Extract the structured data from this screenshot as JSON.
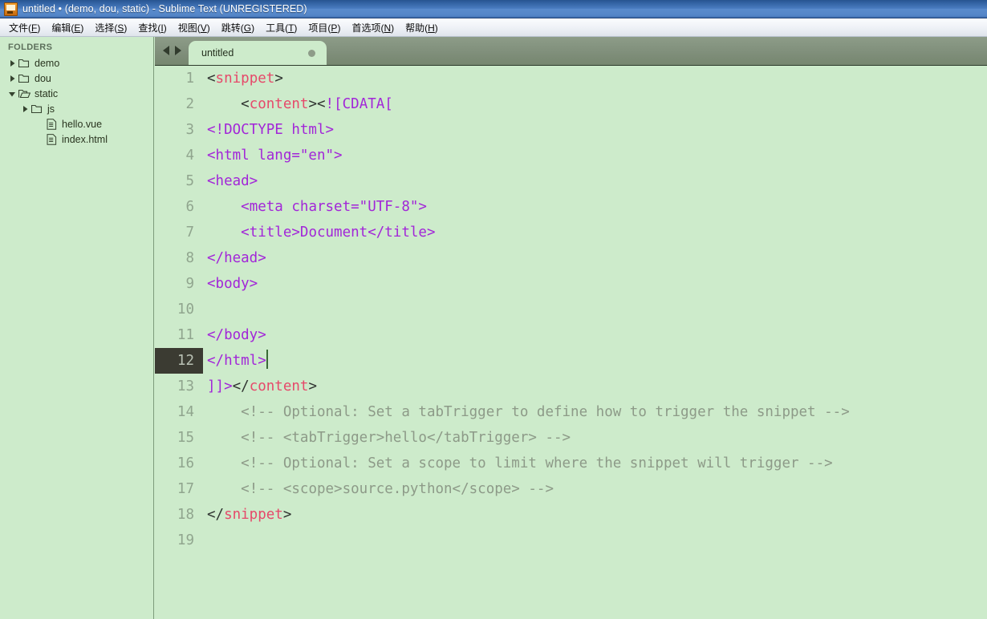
{
  "window": {
    "title": "untitled • (demo, dou, static) - Sublime Text (UNREGISTERED)",
    "icon": "sublime-text-icon"
  },
  "menubar": {
    "items": [
      {
        "label": "文件(F)"
      },
      {
        "label": "编辑(E)"
      },
      {
        "label": "选择(S)"
      },
      {
        "label": "查找(I)"
      },
      {
        "label": "视图(V)"
      },
      {
        "label": "跳转(G)"
      },
      {
        "label": "工具(T)"
      },
      {
        "label": "项目(P)"
      },
      {
        "label": "首选项(N)"
      },
      {
        "label": "帮助(H)"
      }
    ]
  },
  "sidebar": {
    "caption": "FOLDERS",
    "tree": [
      {
        "label": "demo",
        "type": "folder",
        "state": "collapsed",
        "depth": 0
      },
      {
        "label": "dou",
        "type": "folder",
        "state": "collapsed",
        "depth": 0
      },
      {
        "label": "static",
        "type": "folder",
        "state": "expanded",
        "depth": 0
      },
      {
        "label": "js",
        "type": "folder",
        "state": "collapsed",
        "depth": 1
      },
      {
        "label": "hello.vue",
        "type": "file",
        "state": "none",
        "depth": 2
      },
      {
        "label": "index.html",
        "type": "file",
        "state": "none",
        "depth": 2
      }
    ]
  },
  "tabstrip": {
    "prev_label": "",
    "next_label": "",
    "tabs": [
      {
        "label": "untitled",
        "dirty": true,
        "active": true
      }
    ]
  },
  "editor": {
    "active_line": 12,
    "colors": {
      "background": "#cdebcb",
      "tag": "#e6496a",
      "punctuation": "#2f3330",
      "plain_text": "#a226d8",
      "comment": "#8d9a88",
      "gutter_text": "#90a58e",
      "active_gutter_bg": "#3b3b32",
      "tabbar": "#808f7b"
    },
    "lines": [
      {
        "n": "1",
        "segments": [
          {
            "t": "punc",
            "s": "<"
          },
          {
            "t": "tag",
            "s": "snippet"
          },
          {
            "t": "punc",
            "s": ">"
          }
        ]
      },
      {
        "n": "2",
        "segments": [
          {
            "t": "punc",
            "s": "    <"
          },
          {
            "t": "tag",
            "s": "content"
          },
          {
            "t": "punc",
            "s": "><"
          },
          {
            "t": "plain",
            "s": "![CDATA["
          }
        ]
      },
      {
        "n": "3",
        "segments": [
          {
            "t": "plain",
            "s": "<!DOCTYPE html>"
          }
        ]
      },
      {
        "n": "4",
        "segments": [
          {
            "t": "plain",
            "s": "<html lang=\"en\">"
          }
        ]
      },
      {
        "n": "5",
        "segments": [
          {
            "t": "plain",
            "s": "<head>"
          }
        ]
      },
      {
        "n": "6",
        "segments": [
          {
            "t": "plain",
            "s": "    <meta charset=\"UTF-8\">"
          }
        ]
      },
      {
        "n": "7",
        "segments": [
          {
            "t": "plain",
            "s": "    <title>Document</title>"
          }
        ]
      },
      {
        "n": "8",
        "segments": [
          {
            "t": "plain",
            "s": "</head>"
          }
        ]
      },
      {
        "n": "9",
        "segments": [
          {
            "t": "plain",
            "s": "<body>"
          }
        ]
      },
      {
        "n": "10",
        "segments": []
      },
      {
        "n": "11",
        "segments": [
          {
            "t": "plain",
            "s": "</body>"
          }
        ]
      },
      {
        "n": "12",
        "segments": [
          {
            "t": "plain",
            "s": "</html>"
          },
          {
            "t": "caret",
            "s": ""
          }
        ]
      },
      {
        "n": "13",
        "segments": [
          {
            "t": "plain",
            "s": "]]>"
          },
          {
            "t": "punc",
            "s": "</"
          },
          {
            "t": "tag",
            "s": "content"
          },
          {
            "t": "punc",
            "s": ">"
          }
        ]
      },
      {
        "n": "14",
        "segments": [
          {
            "t": "comment",
            "s": "    <!-- Optional: Set a tabTrigger to define how to trigger the snippet -->"
          }
        ]
      },
      {
        "n": "15",
        "segments": [
          {
            "t": "comment",
            "s": "    <!-- <tabTrigger>hello</tabTrigger> -->"
          }
        ]
      },
      {
        "n": "16",
        "segments": [
          {
            "t": "comment",
            "s": "    <!-- Optional: Set a scope to limit where the snippet will trigger -->"
          }
        ]
      },
      {
        "n": "17",
        "segments": [
          {
            "t": "comment",
            "s": "    <!-- <scope>source.python</scope> -->"
          }
        ]
      },
      {
        "n": "18",
        "segments": [
          {
            "t": "punc",
            "s": "</"
          },
          {
            "t": "tag",
            "s": "snippet"
          },
          {
            "t": "punc",
            "s": ">"
          }
        ]
      },
      {
        "n": "19",
        "segments": []
      }
    ]
  }
}
